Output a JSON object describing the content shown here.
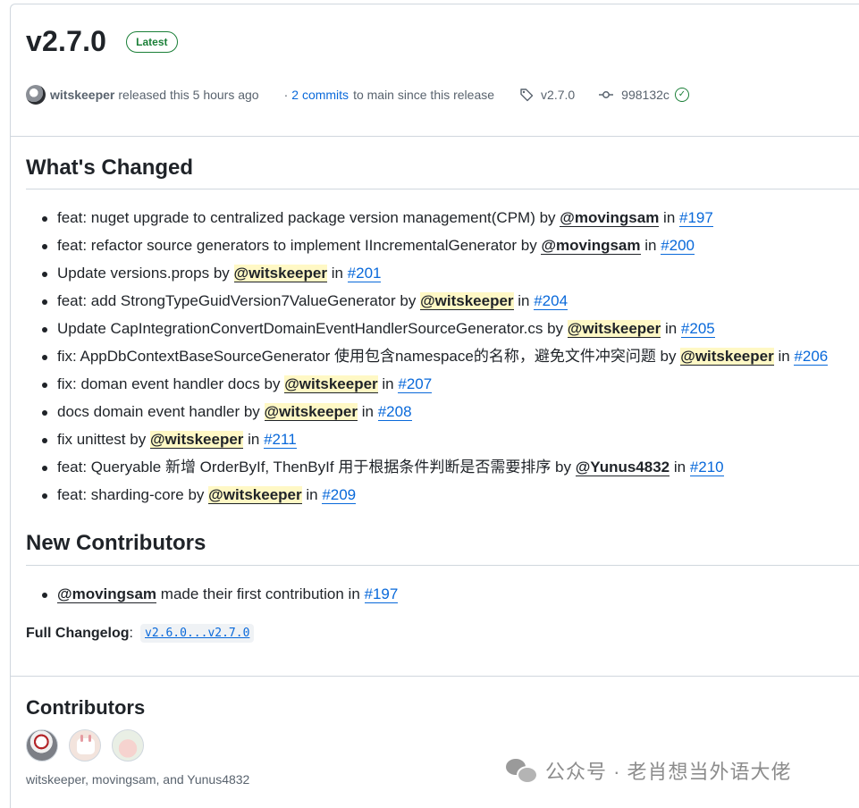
{
  "release": {
    "tag": "v2.7.0",
    "badge": "Latest",
    "author": "witskeeper",
    "released_text": "released this 5 hours ago",
    "dot": "·",
    "commits_link": "2 commits",
    "commits_suffix": "to main since this release",
    "tag_label": "v2.7.0",
    "commit_sha": "998132c"
  },
  "whats_changed": {
    "heading": "What's Changed",
    "items": [
      {
        "text": "feat: nuget upgrade to centralized package version management(CPM) by ",
        "user": "@movingsam",
        "in": " in ",
        "pr": "#197"
      },
      {
        "text": "feat: refactor source generators to implement IIncrementalGenerator by ",
        "user": "@movingsam",
        "in": " in ",
        "pr": "#200"
      },
      {
        "text": "Update versions.props by ",
        "user": "@witskeeper",
        "in": " in ",
        "pr": "#201"
      },
      {
        "text": "feat: add StrongTypeGuidVersion7ValueGenerator by ",
        "user": "@witskeeper",
        "in": " in ",
        "pr": "#204"
      },
      {
        "text": "Update CapIntegrationConvertDomainEventHandlerSourceGenerator.cs by ",
        "user": "@witskeeper",
        "in": " in ",
        "pr": "#205"
      },
      {
        "text": "fix: AppDbContextBaseSourceGenerator 使用包含namespace的名称，避免文件冲突问题 by ",
        "user": "@witskeeper",
        "in": " in ",
        "pr": "#206"
      },
      {
        "text": "fix: doman event handler docs by ",
        "user": "@witskeeper",
        "in": " in ",
        "pr": "#207"
      },
      {
        "text": "docs domain event handler by ",
        "user": "@witskeeper",
        "in": " in ",
        "pr": "#208"
      },
      {
        "text": "fix unittest by ",
        "user": "@witskeeper",
        "in": " in ",
        "pr": "#211"
      },
      {
        "text": "feat: Queryable 新增 OrderByIf, ThenByIf 用于根据条件判断是否需要排序 by ",
        "user": "@Yunus4832",
        "in": " in ",
        "pr": "#210"
      },
      {
        "text": "feat: sharding-core by ",
        "user": "@witskeeper",
        "in": " in ",
        "pr": "#209"
      }
    ]
  },
  "new_contributors": {
    "heading": "New Contributors",
    "user": "@movingsam",
    "text": " made their first contribution in ",
    "pr": "#197"
  },
  "full_changelog": {
    "label": "Full Changelog",
    "colon": ":",
    "range": "v2.6.0...v2.7.0"
  },
  "contributors": {
    "heading": "Contributors",
    "list": "witskeeper, movingsam, and Yunus4832"
  },
  "watermark": "公众号 · 老肖想当外语大佬",
  "colors": {
    "link": "#0969da",
    "latest_badge": "#1a7f37",
    "highlight": "#fff8c5"
  }
}
